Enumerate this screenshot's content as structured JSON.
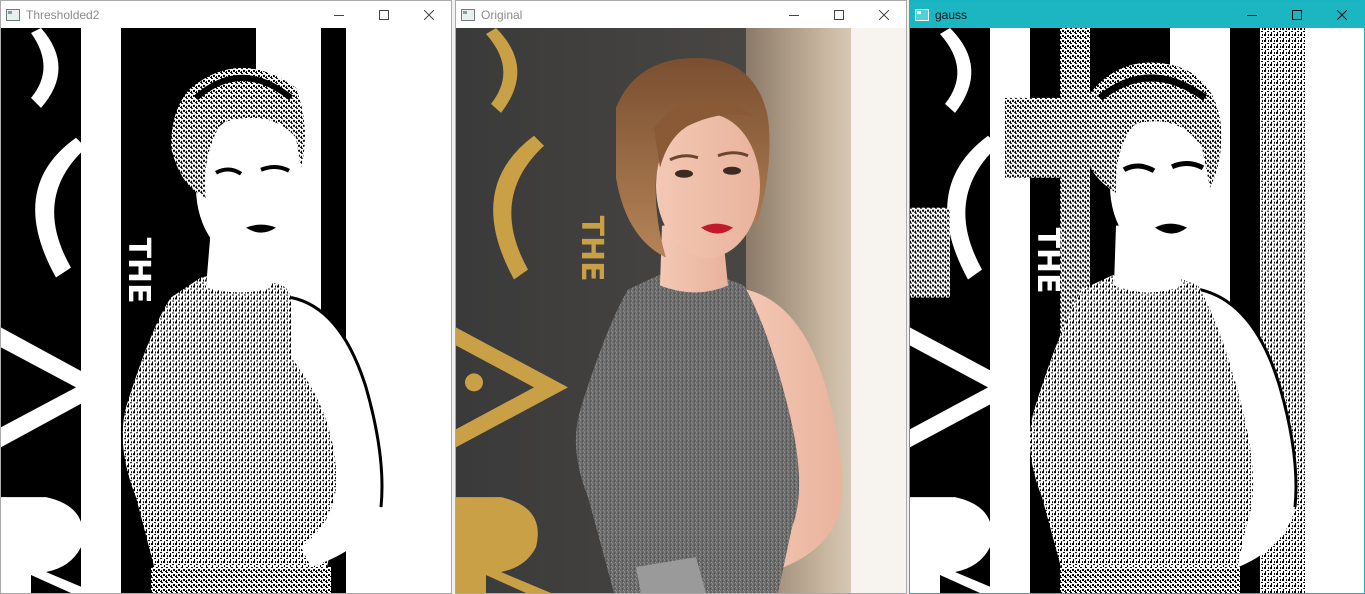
{
  "windows": [
    {
      "title": "Thresholded2",
      "active": false,
      "controls": [
        "minimize-icon",
        "maximize-icon",
        "close-icon"
      ]
    },
    {
      "title": "Original",
      "active": false,
      "controls": [
        "minimize-icon",
        "maximize-icon",
        "close-icon"
      ]
    },
    {
      "title": "gauss",
      "active": true,
      "controls": [
        "minimize-icon",
        "maximize-icon",
        "close-icon"
      ]
    }
  ],
  "colors": {
    "active_titlebar": "#1cb5c2",
    "inactive_title_text": "#8b8b8b",
    "gold_logo": "#c9a045",
    "dress_gray": "#6d6d6d",
    "wall_dark": "#3f3f3f"
  }
}
